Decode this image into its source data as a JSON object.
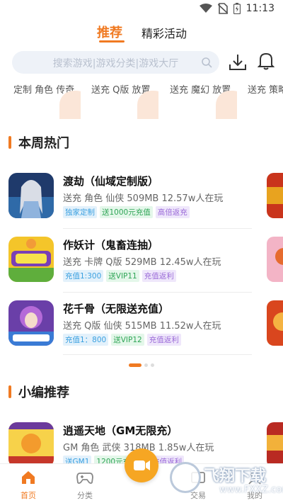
{
  "status_bar": {
    "time": "11:13"
  },
  "tabs": [
    {
      "label": "推荐"
    },
    {
      "label": "精彩活动"
    }
  ],
  "search": {
    "placeholder": "搜索游戏|游戏分类|游戏大厅"
  },
  "categories": [
    {
      "label": "定制 角色 传奇"
    },
    {
      "label": "送充 Q版 放置"
    },
    {
      "label": "送充 魔幻 放置"
    },
    {
      "label": "送充 策略"
    }
  ],
  "section_hot": {
    "title": "本周热门"
  },
  "hot_games": [
    {
      "name": "渡劫（仙域定制版）",
      "meta": "送充 角色 仙侠   509MB  12.57w人在玩",
      "tags": [
        "独家定制",
        "送1000元充值",
        "高倍返充"
      ]
    },
    {
      "name": "作妖计（鬼畜连抽）",
      "meta": "送充 卡牌 Q版   529MB  12.45w人在玩",
      "tags": [
        "充值1:300",
        "送VIP11",
        "充值返利"
      ]
    },
    {
      "name": "花千骨（无限送充值）",
      "meta": "送充 Q版 仙侠   515MB  11.52w人在玩",
      "tags": [
        "充值1：800",
        "送VIP12",
        "充值返利"
      ]
    }
  ],
  "section_editor": {
    "title": "小编推荐"
  },
  "editor_games": [
    {
      "name": "逍遥天地（GM无限充）",
      "meta": "GM 角色 武侠   318MB  1.85w人在玩",
      "tags": [
        "送GM1",
        "1200元充值卡",
        "充值返利"
      ]
    }
  ],
  "bottom_nav": [
    {
      "label": "首页",
      "icon": "home-icon"
    },
    {
      "label": "分类",
      "icon": "gamepad-icon"
    },
    {
      "label": "交易",
      "icon": "trade-icon"
    },
    {
      "label": "我的",
      "icon": "user-icon"
    }
  ],
  "watermark": {
    "text": "飞翔下载",
    "url": "www.FXXZ.com"
  },
  "colors": {
    "accent": "#f07a22",
    "tag_blue": "#3aa0e0",
    "tag_green": "#2fa556",
    "tag_purple": "#9b6bd8"
  }
}
